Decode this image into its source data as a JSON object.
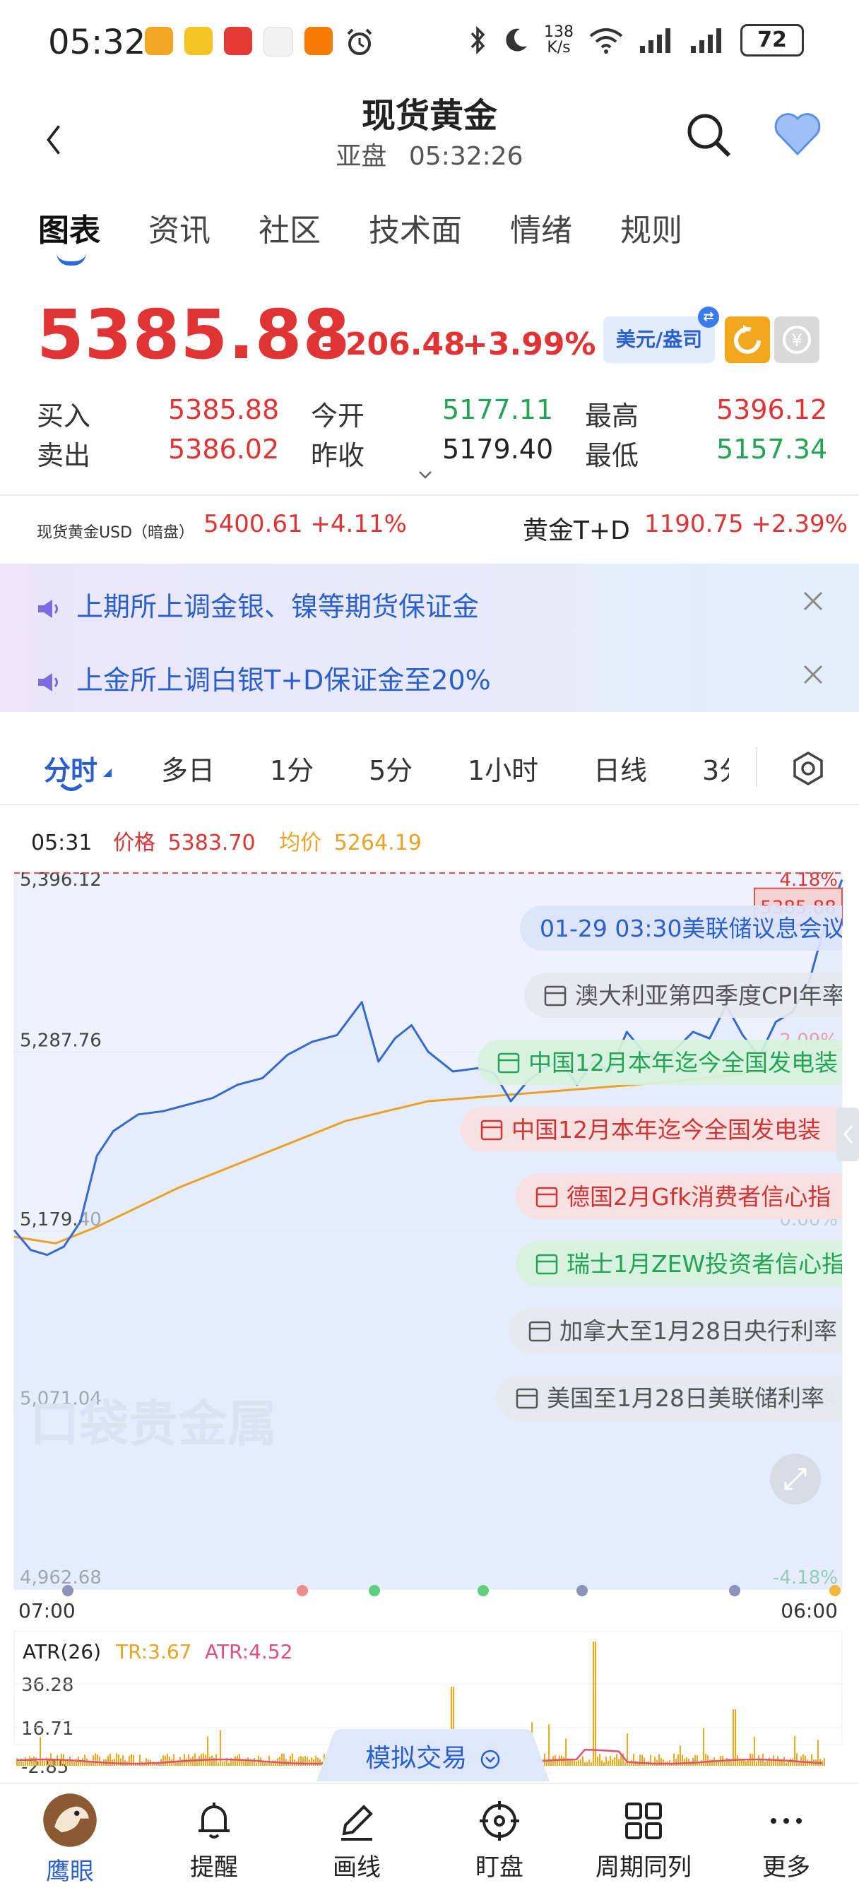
{
  "status_bar": {
    "time": "05:32",
    "net_speed_top": "138",
    "net_speed_unit": "K/s",
    "battery": "72"
  },
  "header": {
    "title": "现货黄金",
    "market": "亚盘",
    "clock": "05:32:26"
  },
  "tabs": [
    "图表",
    "资讯",
    "社区",
    "技术面",
    "情绪",
    "规则"
  ],
  "quote": {
    "price": "5385.88",
    "change": "+206.48",
    "change_pct": "+3.99%",
    "unit": "美元/盎司",
    "buy_label": "买入",
    "buy": "5385.88",
    "sell_label": "卖出",
    "sell": "5386.02",
    "open_label": "今开",
    "open": "5177.11",
    "prev_label": "昨收",
    "prev": "5179.40",
    "high_label": "最高",
    "high": "5396.12",
    "low_label": "最低",
    "low": "5157.34"
  },
  "refs": {
    "dark_label": "现货黄金USD（暗盘）",
    "dark_value": "5400.61 +4.11%",
    "td_label": "黄金T+D",
    "td_value": "1190.75 +2.39%"
  },
  "notices": [
    "上期所上调金银、镍等期货保证金",
    "上金所上调白银T+D保证金至20%"
  ],
  "period_tabs": [
    "分时",
    "多日",
    "1分",
    "5分",
    "1小时",
    "日线",
    "3分"
  ],
  "crosshair": {
    "time": "05:31",
    "price_label": "价格",
    "price": "5383.70",
    "avg_label": "均价",
    "avg": "5264.19"
  },
  "chart_data": {
    "type": "line",
    "title": "",
    "y_ticks": [
      "5,396.12",
      "5,287.76",
      "5,179.40",
      "5,071.04",
      "4,962.68"
    ],
    "y_right_ticks": [
      "4.18%",
      "2.09%",
      "0.00%",
      "-2.09%",
      "-4.18%"
    ],
    "x_ticks": [
      "07:00",
      "06:00"
    ],
    "ylim": [
      4962.68,
      5396.12
    ],
    "last_price_tag": "5385.88",
    "watermark": "口袋贵金属",
    "series": [
      {
        "name": "价格",
        "color": "#3569d6",
        "x": [
          0,
          0.02,
          0.04,
          0.06,
          0.08,
          0.1,
          0.12,
          0.15,
          0.18,
          0.21,
          0.24,
          0.27,
          0.3,
          0.33,
          0.36,
          0.39,
          0.42,
          0.44,
          0.46,
          0.48,
          0.5,
          0.53,
          0.56,
          0.58,
          0.6,
          0.62,
          0.64,
          0.66,
          0.68,
          0.7,
          0.72,
          0.74,
          0.76,
          0.78,
          0.8,
          0.82,
          0.84,
          0.86,
          0.88,
          0.9,
          0.92,
          0.94,
          0.96,
          0.98,
          1.0
        ],
        "values": [
          5180,
          5168,
          5165,
          5170,
          5185,
          5225,
          5240,
          5250,
          5252,
          5256,
          5260,
          5268,
          5272,
          5286,
          5294,
          5298,
          5318,
          5282,
          5296,
          5304,
          5288,
          5276,
          5278,
          5275,
          5258,
          5270,
          5278,
          5282,
          5268,
          5282,
          5276,
          5300,
          5288,
          5282,
          5290,
          5300,
          5296,
          5316,
          5298,
          5285,
          5306,
          5312,
          5330,
          5366,
          5392
        ]
      },
      {
        "name": "均价",
        "color": "#e9a226",
        "x": [
          0,
          0.05,
          0.1,
          0.2,
          0.3,
          0.4,
          0.5,
          0.6,
          0.7,
          0.8,
          0.9,
          0.95,
          1.0
        ],
        "values": [
          5176,
          5172,
          5182,
          5206,
          5226,
          5246,
          5258,
          5262,
          5266,
          5270,
          5276,
          5282,
          5290
        ]
      }
    ],
    "events": [
      {
        "text": "01-29 03:30美联储议息会议",
        "style": "blue",
        "icon": "none"
      },
      {
        "text": "澳大利亚第四季度CPI年率",
        "style": "gray",
        "icon": "calendar"
      },
      {
        "text": "中国12月本年迄今全国发电装",
        "style": "green",
        "icon": "calendar"
      },
      {
        "text": "中国12月本年迄今全国发电装",
        "style": "red",
        "icon": "calendar"
      },
      {
        "text": "德国2月Gfk消费者信心指",
        "style": "red",
        "icon": "calendar"
      },
      {
        "text": "瑞士1月ZEW投资者信心指",
        "style": "green",
        "icon": "calendar"
      },
      {
        "text": "加拿大至1月28日央行利率",
        "style": "gray",
        "icon": "calendar"
      },
      {
        "text": "美国至1月28日美联储利率",
        "style": "gray",
        "icon": "calendar"
      }
    ]
  },
  "atr": {
    "label": "ATR(26)",
    "tr_label": "TR:3.67",
    "atr_label": "ATR:4.52",
    "y_ticks": [
      "36.28",
      "16.71",
      "-2.85"
    ]
  },
  "sim_trade": "模拟交易",
  "bottom_nav": [
    "鹰眼",
    "提醒",
    "画线",
    "盯盘",
    "周期同列",
    "更多"
  ],
  "colors": {
    "up": "#e03434",
    "down": "#23a454",
    "accent": "#2a5fcf",
    "price_line": "#3569d6",
    "avg_line": "#e9a226"
  }
}
